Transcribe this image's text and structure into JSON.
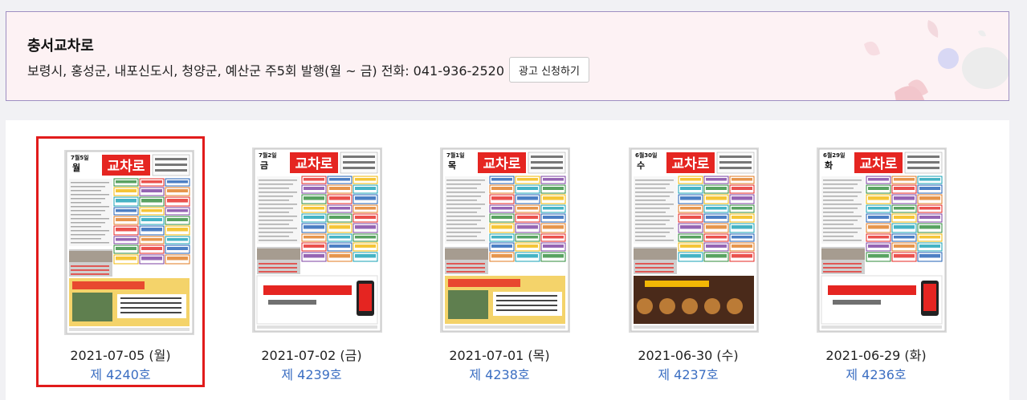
{
  "banner": {
    "title": "충서교차로",
    "description": "보령시, 홍성군, 내포신도시, 청양군, 예산군 주5회 발행(월 ~ 금) 전화: 041-936-2520",
    "button_label": "광고 신청하기"
  },
  "issues": [
    {
      "date": "2021-07-05 (월)",
      "number": "제 4240호",
      "masthead": "교차로",
      "cover_date": "7월5일",
      "cover_day": "월",
      "selected": true
    },
    {
      "date": "2021-07-02 (금)",
      "number": "제 4239호",
      "masthead": "교차로",
      "cover_date": "7월2일",
      "cover_day": "금",
      "selected": false
    },
    {
      "date": "2021-07-01 (목)",
      "number": "제 4238호",
      "masthead": "교차로",
      "cover_date": "7월1일",
      "cover_day": "목",
      "selected": false
    },
    {
      "date": "2021-06-30 (수)",
      "number": "제 4237호",
      "masthead": "교차로",
      "cover_date": "6월30일",
      "cover_day": "수",
      "selected": false
    },
    {
      "date": "2021-06-29 (화)",
      "number": "제 4236호",
      "masthead": "교차로",
      "cover_date": "6월29일",
      "cover_day": "화",
      "selected": false
    }
  ],
  "colors": {
    "selected_border": "#e11b1b",
    "issue_link": "#3b6ec2",
    "masthead_red": "#e52521"
  }
}
